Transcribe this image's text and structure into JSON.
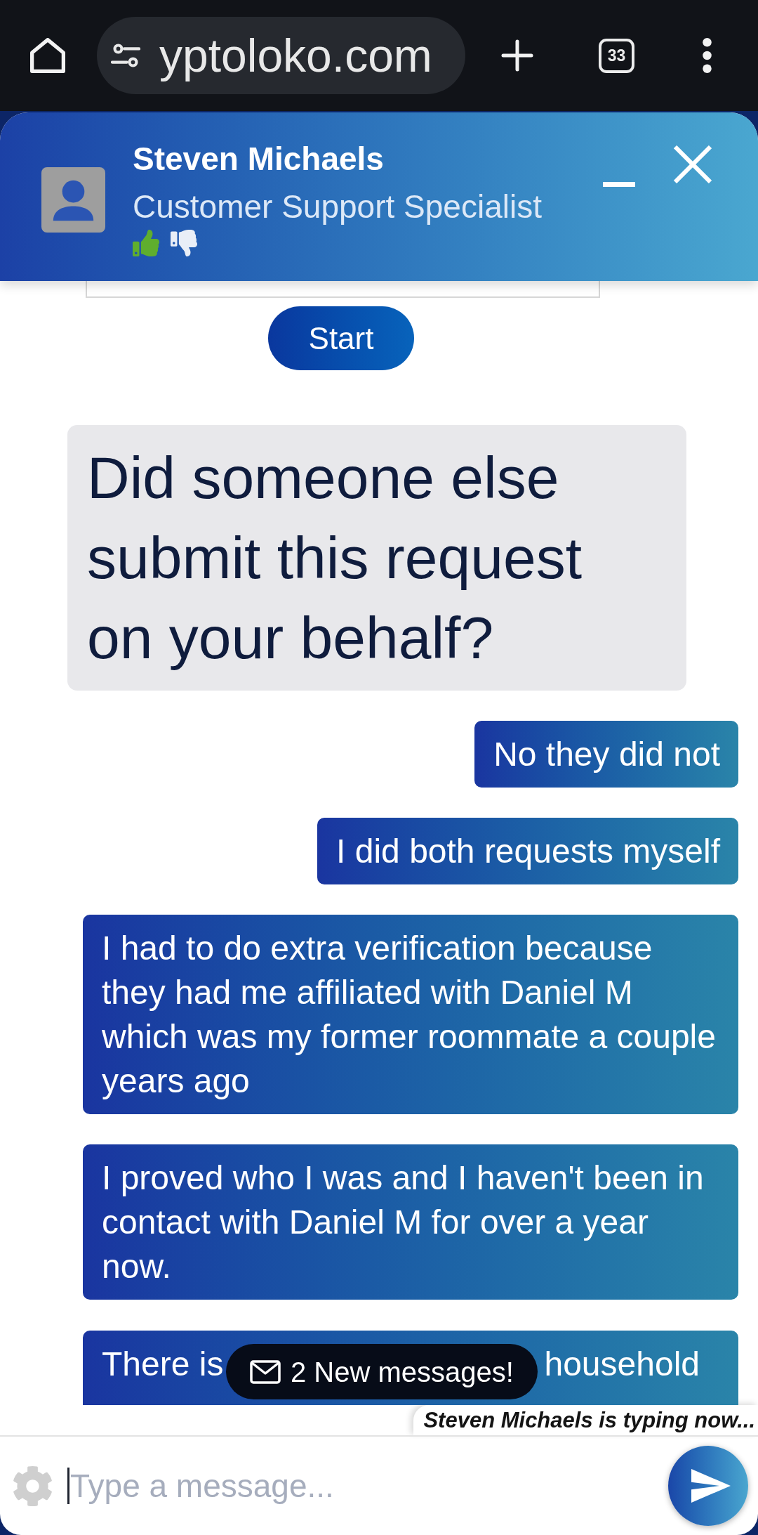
{
  "browser": {
    "url": "yptoloko.com",
    "tab_count": "33"
  },
  "chat": {
    "agent": {
      "name": "Steven Michaels",
      "title": "Customer Support Specialist"
    },
    "rating": [
      {
        "kind": "up",
        "selected": true
      },
      {
        "kind": "down",
        "selected": false
      }
    ],
    "start_button": "Start",
    "messages": [
      {
        "kind": "agent",
        "text": "Did someone else submit this request on your behalf?"
      },
      {
        "kind": "visitor",
        "text": "No they did not"
      },
      {
        "kind": "visitor",
        "text": "I did both requests myself"
      },
      {
        "kind": "visitor",
        "text": "I had to do extra verification because they had me affiliated with Daniel M which was my former roommate a couple years ago"
      },
      {
        "kind": "visitor",
        "text": "I proved who I was and I haven't been in contact with Daniel M for over a year now."
      },
      {
        "kind": "partial",
        "parts": [
          "There is",
          "household"
        ]
      }
    ],
    "new_messages": "2 New messages!",
    "typing": "Steven Michaels is typing now...",
    "composer": {
      "placeholder": "Type a message..."
    }
  }
}
